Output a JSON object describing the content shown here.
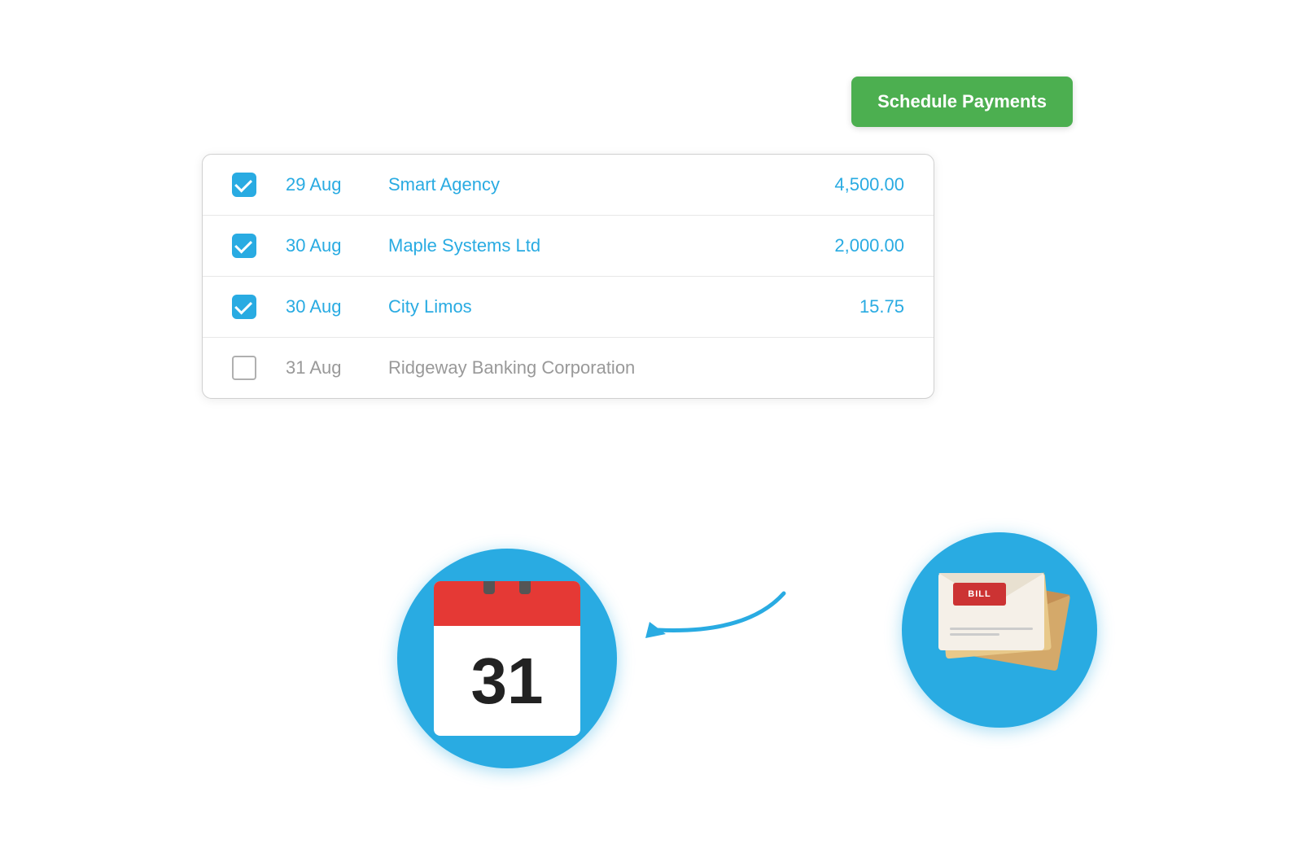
{
  "button": {
    "schedule_label": "Schedule Payments",
    "bg_color": "#4CAF50"
  },
  "payments": [
    {
      "date": "29 Aug",
      "name": "Smart Agency",
      "amount": "4,500.00",
      "checked": true
    },
    {
      "date": "30 Aug",
      "name": "Maple Systems Ltd",
      "amount": "2,000.00",
      "checked": true
    },
    {
      "date": "30 Aug",
      "name": "City Limos",
      "amount": "15.75",
      "checked": true
    },
    {
      "date": "31 Aug",
      "name": "Ridgeway Banking Corporation",
      "amount": "",
      "checked": false
    }
  ],
  "calendar": {
    "day": "31"
  },
  "bill": {
    "stamp_text": "BILL"
  },
  "colors": {
    "blue": "#29ABE2",
    "green": "#4CAF50"
  }
}
